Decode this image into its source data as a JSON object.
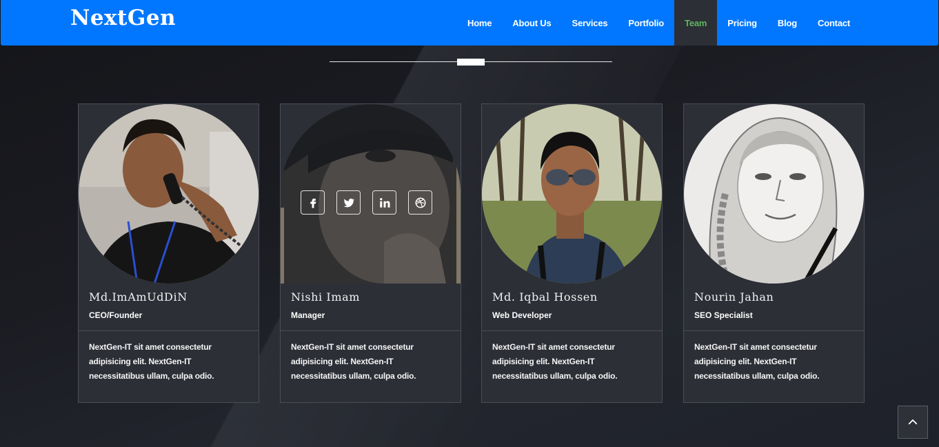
{
  "brand": {
    "name": "NextGen"
  },
  "nav": {
    "items": [
      {
        "label": "Home"
      },
      {
        "label": "About Us"
      },
      {
        "label": "Services"
      },
      {
        "label": "Portfolio"
      },
      {
        "label": "Team"
      },
      {
        "label": "Pricing"
      },
      {
        "label": "Blog"
      },
      {
        "label": "Contact"
      }
    ],
    "active": "Team"
  },
  "team": {
    "members": [
      {
        "name": "Md.ImAmUdDiN",
        "role": "CEO/Founder",
        "description": "NextGen-IT sit amet consectetur adipisicing elit. NextGen-IT necessitatibus ullam, culpa odio.",
        "photo_icon": "person-on-phone-photo"
      },
      {
        "name": "Nishi Imam",
        "role": "Manager",
        "description": "NextGen-IT sit amet consectetur adipisicing elit. NextGen-IT necessitatibus ullam, culpa odio.",
        "photo_icon": "woman-in-hat-photo",
        "socials": [
          "facebook-icon",
          "twitter-icon",
          "linkedin-icon",
          "dribbble-icon"
        ]
      },
      {
        "name": "Md. Iqbal Hossen",
        "role": "Web Developer",
        "description": "NextGen-IT sit amet consectetur adipisicing elit. NextGen-IT necessitatibus ullam, culpa odio.",
        "photo_icon": "man-with-sunglasses-photo"
      },
      {
        "name": "Nourin Jahan",
        "role": "SEO Specialist",
        "description": "NextGen-IT sit amet consectetur adipisicing elit. NextGen-IT necessitatibus ullam, culpa odio.",
        "photo_icon": "pencil-sketch-woman-photo"
      }
    ]
  },
  "colors": {
    "navbar": "#0077fe",
    "active_nav_text": "#5cb85c",
    "card_bg": "#2d2f37"
  },
  "scroll_top": {
    "icon": "chevron-up-icon"
  }
}
